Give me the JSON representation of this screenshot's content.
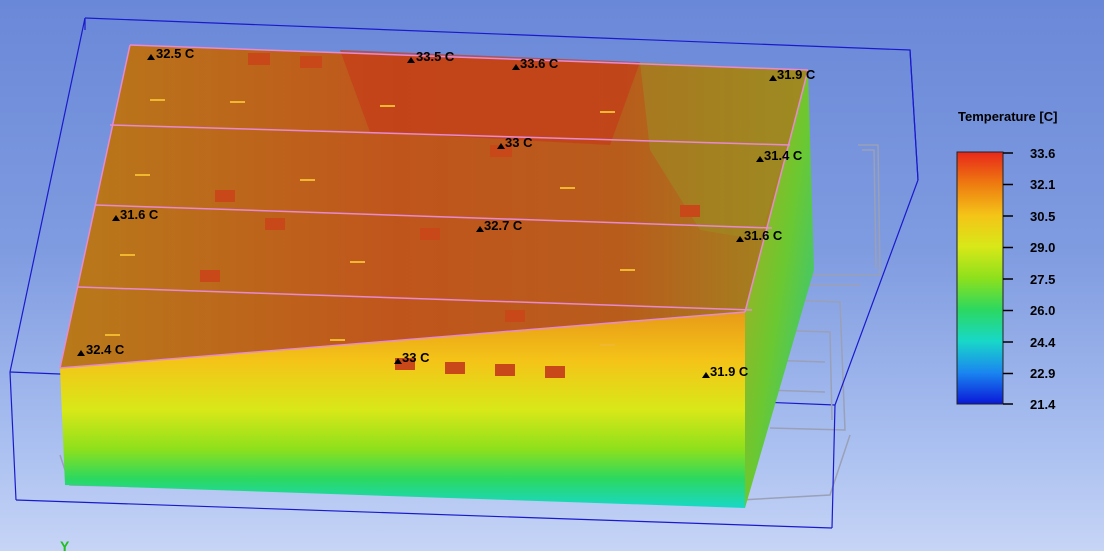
{
  "legend": {
    "title": "Temperature [C]",
    "ticks": [
      "33.6",
      "32.1",
      "30.5",
      "29.0",
      "27.5",
      "26.0",
      "24.4",
      "22.9",
      "21.4"
    ],
    "colors": [
      "#e8281a",
      "#ee7a10",
      "#f4c418",
      "#d8e818",
      "#8ee01c",
      "#2cd860",
      "#18d8c8",
      "#1a86f0",
      "#0a18d8"
    ]
  },
  "probes": {
    "p1": "32.5 C",
    "p2": "33.5 C",
    "p3": "33.6 C",
    "p4": "31.9 C",
    "p5": "33 C",
    "p6": "31.4 C",
    "p7": "31.6 C",
    "p8": "32.7 C",
    "p9": "31.6 C",
    "p10": "32.4 C",
    "p11": "33 C",
    "p12": "31.9 C"
  },
  "axis_indicator": "Y"
}
